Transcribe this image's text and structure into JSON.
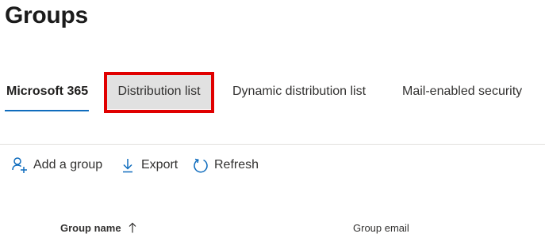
{
  "page": {
    "title": "Groups"
  },
  "tabs": [
    {
      "label": "Microsoft 365",
      "active": true
    },
    {
      "label": "Distribution list",
      "highlighted": true
    },
    {
      "label": "Dynamic distribution list"
    },
    {
      "label": "Mail-enabled security"
    }
  ],
  "toolbar": {
    "add_group_label": "Add a group",
    "add_group_icon": "add-person-icon",
    "export_label": "Export",
    "export_icon": "download-arrow-icon",
    "refresh_label": "Refresh",
    "refresh_icon": "refresh-icon"
  },
  "table": {
    "columns": [
      {
        "label": "Group name",
        "sort": "ascending",
        "sort_icon": "arrow-up-icon"
      },
      {
        "label": "Group email"
      }
    ]
  },
  "colors": {
    "accent": "#0f6cbd",
    "highlight_border": "#e00000",
    "highlight_fill": "#e1e1e1"
  }
}
